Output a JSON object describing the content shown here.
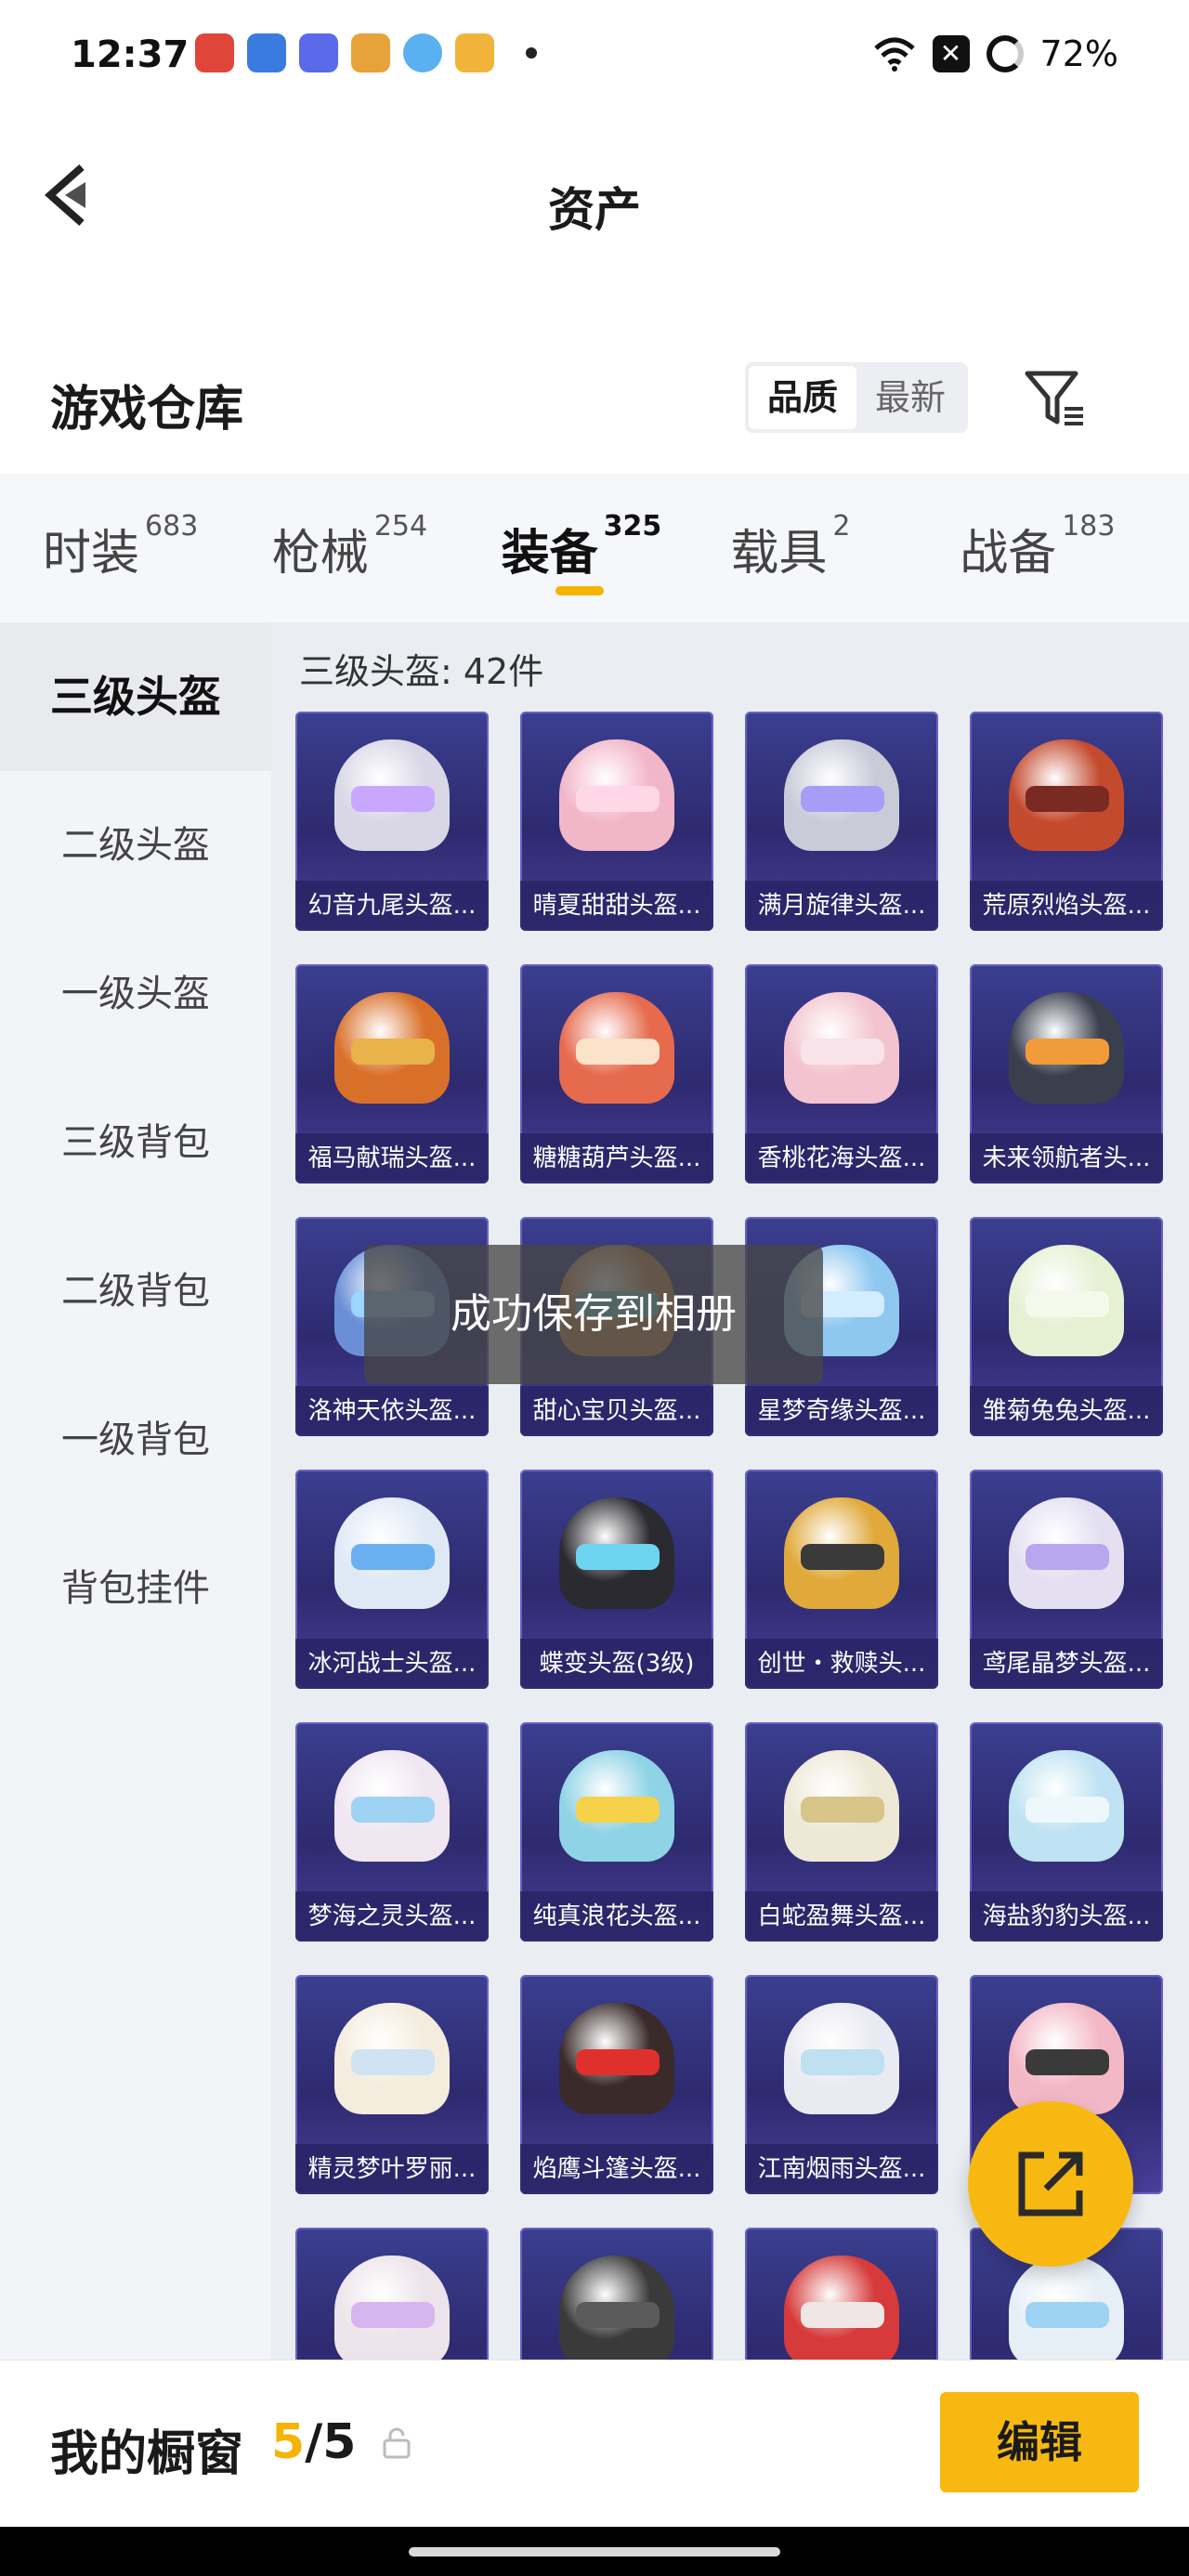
{
  "status": {
    "time": "12:37",
    "battery": "72%"
  },
  "nav": {
    "title": "资产"
  },
  "header": {
    "title": "游戏仓库",
    "sort_options": [
      "品质",
      "最新"
    ],
    "sort_active": "品质"
  },
  "tabs": [
    {
      "label": "时装",
      "count": "683"
    },
    {
      "label": "枪械",
      "count": "254"
    },
    {
      "label": "装备",
      "count": "325"
    },
    {
      "label": "载具",
      "count": "2"
    },
    {
      "label": "战备",
      "count": "183"
    }
  ],
  "sidebar": {
    "items": [
      "三级头盔",
      "二级头盔",
      "一级头盔",
      "三级背包",
      "二级背包",
      "一级背包",
      "背包挂件"
    ]
  },
  "content": {
    "heading": "三级头盔: 42件"
  },
  "items": [
    {
      "name": "幻音九尾头盔...",
      "color": "#d9d6e6",
      "visor": "#c9a7ff"
    },
    {
      "name": "晴夏甜甜头盔...",
      "color": "#f2b6c9",
      "visor": "#ffd7e6"
    },
    {
      "name": "满月旋律头盔...",
      "color": "#c9cbd9",
      "visor": "#a89cf7"
    },
    {
      "name": "荒原烈焰头盔...",
      "color": "#c44a2e",
      "visor": "#7a2a22"
    },
    {
      "name": "福马献瑞头盔...",
      "color": "#d9702a",
      "visor": "#e8b34a"
    },
    {
      "name": "糖糖葫芦头盔...",
      "color": "#e66a4e",
      "visor": "#fbe3c9"
    },
    {
      "name": "香桃花海头盔...",
      "color": "#f3c4cf",
      "visor": "#f8e3ea"
    },
    {
      "name": "未来领航者头...",
      "color": "#3a3f4e",
      "visor": "#f29b3a"
    },
    {
      "name": "洛神天依头盔...",
      "color": "#6a8fd6",
      "visor": "#9bd6ff"
    },
    {
      "name": "甜心宝贝头盔...",
      "color": "#c98a4e",
      "visor": "#7fd3c9"
    },
    {
      "name": "星梦奇缘头盔...",
      "color": "#8ec7f0",
      "visor": "#d3ecff"
    },
    {
      "name": "雏菊兔兔头盔...",
      "color": "#e6f0d3",
      "visor": "#f4f9ea"
    },
    {
      "name": "冰河战士头盔...",
      "color": "#dfe9f6",
      "visor": "#6ab0f0"
    },
    {
      "name": "蝶变头盔(3级)",
      "color": "#2a2a30",
      "visor": "#6fd4ef"
    },
    {
      "name": "创世・救赎头...",
      "color": "#e0a93a",
      "visor": "#3a3a3a"
    },
    {
      "name": "鸢尾晶梦头盔...",
      "color": "#e4e0f2",
      "visor": "#b8a7ef"
    },
    {
      "name": "梦海之灵头盔...",
      "color": "#f0e6f2",
      "visor": "#9fd3f3"
    },
    {
      "name": "纯真浪花头盔...",
      "color": "#8fd3e6",
      "visor": "#f6d24a"
    },
    {
      "name": "白蛇盈舞头盔...",
      "color": "#eee8d6",
      "visor": "#d8c58a"
    },
    {
      "name": "海盐豹豹头盔...",
      "color": "#bfe3f2",
      "visor": "#eef7fc"
    },
    {
      "name": "精灵梦叶罗丽...",
      "color": "#f4ecdc",
      "visor": "#cfe3f2"
    },
    {
      "name": "焰鹰斗篷头盔...",
      "color": "#3a2a2a",
      "visor": "#e0302e"
    },
    {
      "name": "江南烟雨头盔...",
      "color": "#eaeaf2",
      "visor": "#bfe0f0"
    },
    {
      "name": "",
      "color": "#f3b8c6",
      "visor": "#3a3a3a"
    },
    {
      "name": "",
      "color": "#ece4ea",
      "visor": "#d7b6f0"
    },
    {
      "name": "",
      "color": "#3a3a3a",
      "visor": "#5a5a5a"
    },
    {
      "name": "",
      "color": "#d63a3a",
      "visor": "#f0e6e6"
    },
    {
      "name": "",
      "color": "#e6eef6",
      "visor": "#9fd3f3"
    }
  ],
  "toast": {
    "text": "成功保存到相册"
  },
  "bottom": {
    "label": "我的橱窗",
    "count_current": "5",
    "count_sep": "/",
    "count_total": "5",
    "edit_label": "编辑"
  },
  "colors": {
    "accent": "#f7b911",
    "card_bg": "#3a3f8f"
  }
}
